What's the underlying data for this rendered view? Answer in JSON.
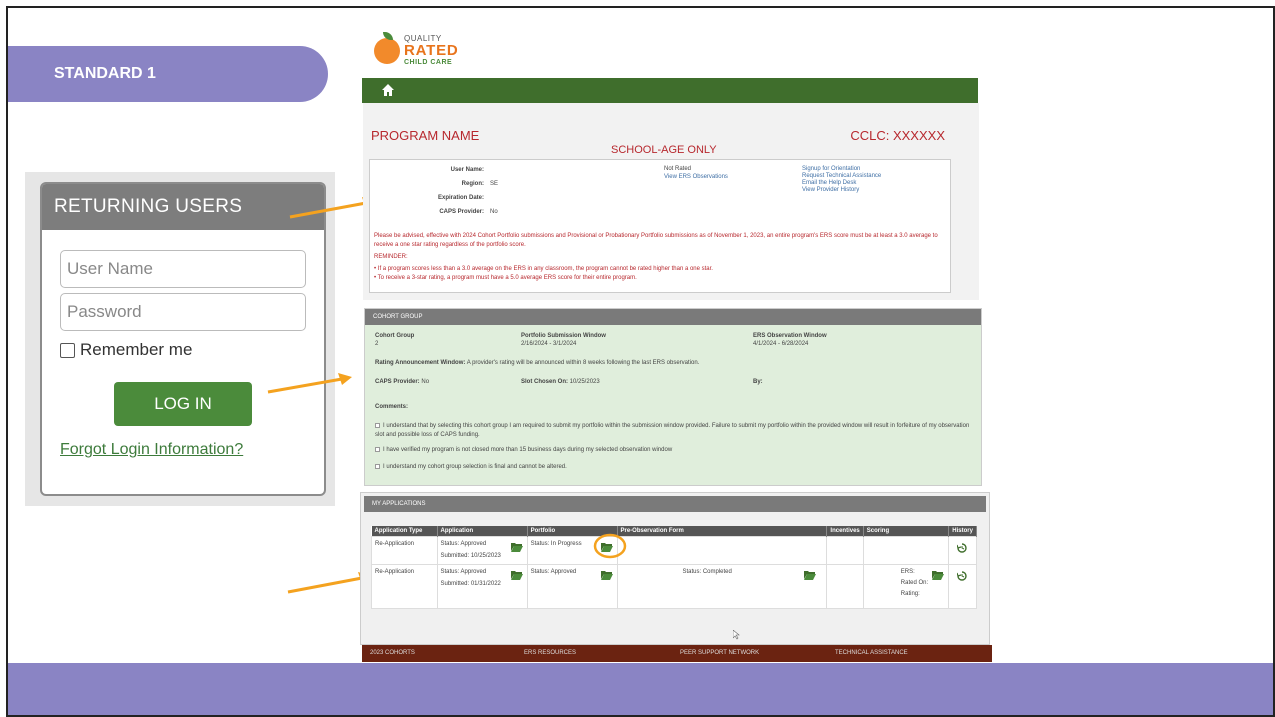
{
  "slide": {
    "standard_label": "STANDARD 1",
    "accent": "#8a84c4"
  },
  "login": {
    "heading": "RETURNING USERS",
    "username_placeholder": "User Name",
    "password_placeholder": "Password",
    "remember_label": "Remember me",
    "login_button": "LOG IN",
    "forgot_link": "Forgot Login Information?"
  },
  "logo": {
    "line1": "QUALITY",
    "line2": "RATED",
    "line3": "CHILD CARE"
  },
  "nav": {
    "home_icon": "home-icon"
  },
  "program": {
    "name": "PROGRAM NAME",
    "school_age": "SCHOOL-AGE ONLY",
    "cclc": "CCLC: XXXXXX"
  },
  "info": {
    "user_name_label": "User Name:",
    "user_name_value": "",
    "region_label": "Region:",
    "region_value": "SE",
    "expiration_label": "Expiration Date:",
    "expiration_value": "",
    "caps_label": "CAPS Provider:",
    "caps_value": "No",
    "rating_status": "Not Rated",
    "view_ers": "View ERS Observations",
    "links": [
      "Signup for Orientation",
      "Request Technical Assistance",
      "Email the Help Desk",
      "View Provider History"
    ],
    "notice": "Please be advised, effective with 2024 Cohort Portfolio submissions and Provisional or Probationary Portfolio submissions as of November 1, 2023, an entire program's ERS score must be at least a 3.0 average to receive a one star rating regardless of the portfolio score.",
    "reminder_label": "REMINDER:",
    "reminders": [
      "If a program scores less than a 3.0 average on the ERS in any classroom, the program cannot be rated higher than a one star.",
      "To receive a 3-star rating, a program must have a 5.0 average ERS score for their entire program."
    ]
  },
  "cohort": {
    "title": "COHORT GROUP",
    "cohort_group_label": "Cohort Group",
    "cohort_group_value": "2",
    "portfolio_window_label": "Portfolio Submission Window",
    "portfolio_window_value": "2/16/2024 - 3/1/2024",
    "ers_window_label": "ERS Observation Window",
    "ers_window_value": "4/1/2024 - 6/28/2024",
    "rating_window_label": "Rating Announcement Window:",
    "rating_window_value": "A provider's rating will be announced within 8 weeks following the last ERS observation.",
    "caps_label": "CAPS Provider:",
    "caps_value": "No",
    "slot_label": "Slot Chosen On:",
    "slot_value": "10/25/2023",
    "by_label": "By:",
    "comments_label": "Comments:",
    "checks": [
      "I understand that by selecting this cohort group I am required to submit my portfolio within the submission window provided. Failure to submit my portfolio within the provided window will result in forfeiture of my observation slot and possible loss of CAPS funding.",
      "I have verified my program is not closed more than 15 business days during my selected observation window",
      "I understand my cohort group selection is final and cannot be altered."
    ]
  },
  "applications": {
    "title": "MY APPLICATIONS",
    "headers": [
      "Application Type",
      "Application",
      "Portfolio",
      "Pre-Observation Form",
      "Incentives",
      "Scoring",
      "History"
    ],
    "rows": [
      {
        "type": "Re-Application",
        "status": "Status: Approved",
        "submitted": "Submitted: 10/25/2023",
        "portfolio_status": "Status: In Progress",
        "pre_obs_status": "",
        "ers": "",
        "rated_on": "",
        "rating": ""
      },
      {
        "type": "Re-Application",
        "status": "Status: Approved",
        "submitted": "Submitted: 01/31/2022",
        "portfolio_status": "Status: Approved",
        "pre_obs_status": "Status: Completed",
        "ers": "ERS:",
        "rated_on": "Rated On:",
        "rating": "Rating:"
      }
    ]
  },
  "footer_links": [
    "2023 COHORTS",
    "ERS RESOURCES",
    "PEER SUPPORT NETWORK",
    "TECHNICAL ASSISTANCE"
  ]
}
